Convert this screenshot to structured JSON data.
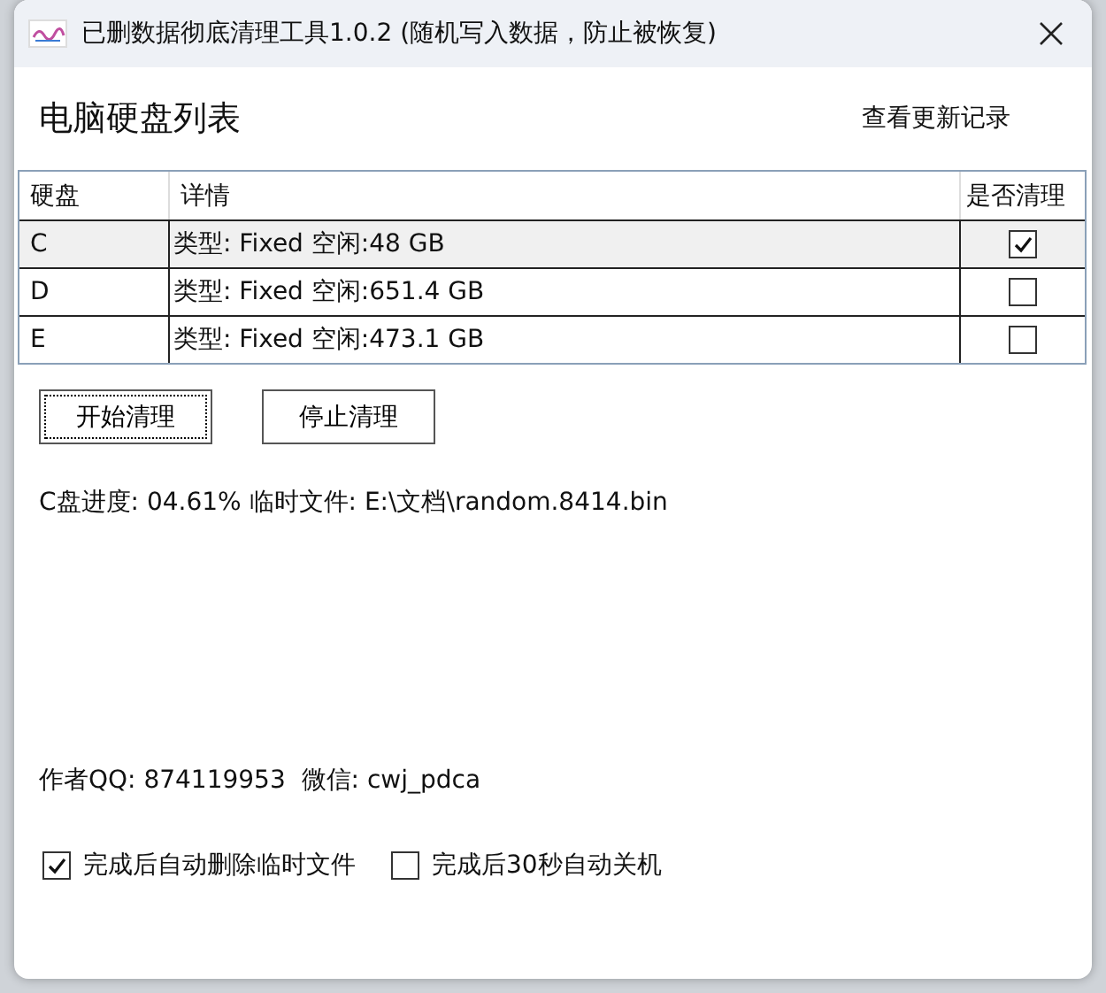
{
  "window": {
    "title": "已删数据彻底清理工具1.0.2 (随机写入数据，防止被恢复)"
  },
  "heading": "电脑硬盘列表",
  "update_link": "查看更新记录",
  "table": {
    "columns": [
      "硬盘",
      "详情",
      "是否清理"
    ],
    "rows": [
      {
        "disk": "C",
        "detail": "类型: Fixed 空闲:48 GB",
        "checked": true,
        "selected": true
      },
      {
        "disk": "D",
        "detail": "类型: Fixed 空闲:651.4 GB",
        "checked": false,
        "selected": false
      },
      {
        "disk": "E",
        "detail": "类型: Fixed 空闲:473.1 GB",
        "checked": false,
        "selected": false
      }
    ]
  },
  "buttons": [
    {
      "label": "开始清理",
      "focused": true
    },
    {
      "label": "停止清理",
      "focused": false
    }
  ],
  "progress": "C盘进度: 04.61% 临时文件: E:\\文档\\random.8414.bin",
  "author": "作者QQ: 874119953  微信: cwj_pdca",
  "options": [
    {
      "label": "完成后自动删除临时文件",
      "checked": true
    },
    {
      "label": "完成后30秒自动关机",
      "checked": false
    }
  ]
}
